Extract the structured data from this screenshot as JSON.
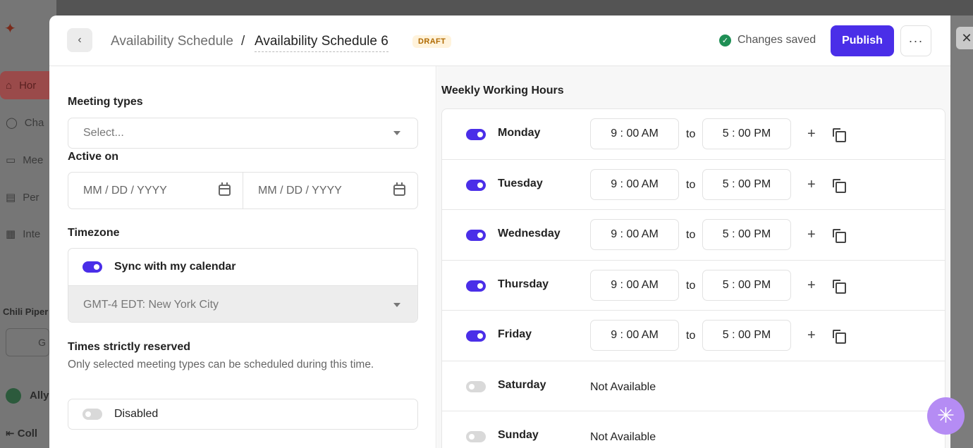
{
  "background": {
    "nav": [
      "Hor",
      "Cha",
      "Mee",
      "Per",
      "Inte"
    ],
    "section_label": "Chili Piper",
    "button_label": "G",
    "user_label": "Ally",
    "collapse_label": "Coll"
  },
  "header": {
    "breadcrumb_parent": "Availability Schedule",
    "breadcrumb_separator": "/",
    "breadcrumb_current": "Availability Schedule 6",
    "status_badge": "DRAFT",
    "save_status": "Changes saved",
    "publish_label": "Publish",
    "more_label": "···"
  },
  "form": {
    "meeting_types_label": "Meeting types",
    "meeting_types_placeholder": "Select...",
    "active_on_label": "Active on",
    "start_date_placeholder": "MM / DD / YYYY",
    "end_date_placeholder": "MM / DD / YYYY",
    "timezone_label": "Timezone",
    "sync_calendar_label": "Sync with my calendar",
    "sync_calendar_on": true,
    "timezone_value": "GMT-4  EDT: New York City",
    "reserved_label": "Times strictly reserved",
    "reserved_description": "Only selected meeting types can be scheduled during this time.",
    "reserved_toggle_label": "Disabled",
    "reserved_on": false
  },
  "weekly": {
    "title": "Weekly Working Hours",
    "to_label": "to",
    "days": [
      {
        "name": "Monday",
        "enabled": true,
        "start": "9 : 00  AM",
        "end": "5 : 00  PM"
      },
      {
        "name": "Tuesday",
        "enabled": true,
        "start": "9 : 00  AM",
        "end": "5 : 00  PM"
      },
      {
        "name": "Wednesday",
        "enabled": true,
        "start": "9 : 00  AM",
        "end": "5 : 00  PM"
      },
      {
        "name": "Thursday",
        "enabled": true,
        "start": "9 : 00  AM",
        "end": "5 : 00  PM"
      },
      {
        "name": "Friday",
        "enabled": true,
        "start": "9 : 00  AM",
        "end": "5 : 00  PM"
      },
      {
        "name": "Saturday",
        "enabled": false,
        "unavailable_text": "Not Available"
      },
      {
        "name": "Sunday",
        "enabled": false,
        "unavailable_text": "Not Available"
      }
    ]
  },
  "colors": {
    "accent": "#4a2ee8",
    "success": "#1f8f55",
    "draft_badge": "#b06a00"
  }
}
